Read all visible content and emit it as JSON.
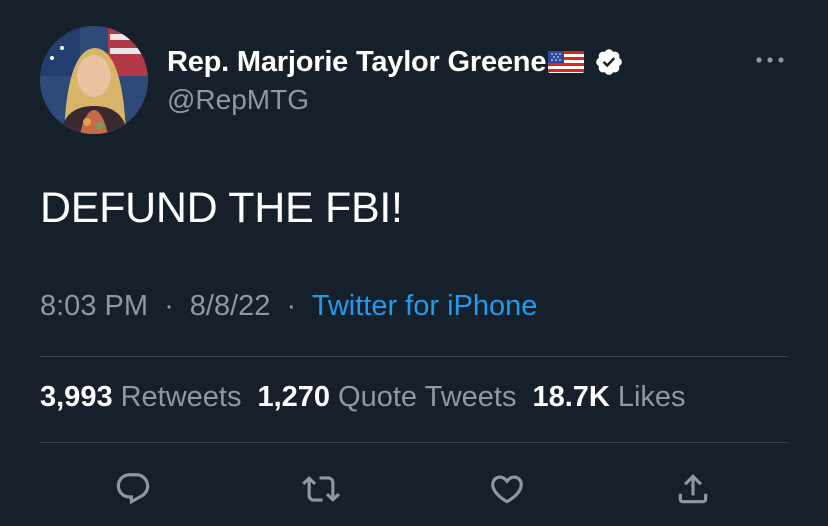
{
  "author": {
    "display_name": "Rep. Marjorie Taylor Greene",
    "flag_icon": "us-flag-emoji",
    "verified_icon": "verified-badge-icon",
    "handle": "@RepMTG"
  },
  "more_icon": "more-options-icon",
  "tweet": {
    "text": "DEFUND THE FBI!",
    "time": "8:03 PM",
    "separator": "·",
    "date": "8/8/22",
    "source": "Twitter for iPhone"
  },
  "stats": {
    "retweets_count": "3,993",
    "retweets_label": "Retweets",
    "quotes_count": "1,270",
    "quotes_label": "Quote Tweets",
    "likes_count": "18.7K",
    "likes_label": "Likes"
  },
  "actions": [
    "reply-icon",
    "retweet-icon",
    "like-icon",
    "share-icon"
  ],
  "colors": {
    "background": "#15202b",
    "primary_text": "#ffffff",
    "secondary_text": "#8b98a5",
    "link": "#1d9bf0",
    "divider": "#38444d"
  }
}
